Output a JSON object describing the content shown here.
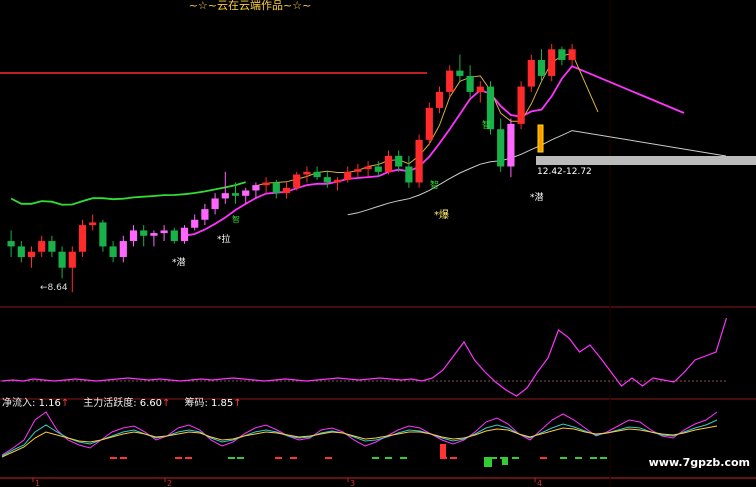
{
  "title": "~☆~云在云端作品~☆~",
  "watermark": "www.7gpzb.com",
  "colors": {
    "background": "#000000",
    "divider": "#8b1a1a",
    "resistance": "#ff2a2a",
    "up_candle": "#ff2a2a",
    "down_candle": "#19b24a",
    "pink_candle": "#ff66ff",
    "green_ma": "#33dd33",
    "magenta_ma": "#ff33ff",
    "gray_ma": "#cccccc",
    "yellow_ma": "#d4b040",
    "band": "#bbbbbb",
    "axis": "#cc2222"
  },
  "indicators": [
    {
      "name": "净流入",
      "value": "1.16",
      "arrow": "↑"
    },
    {
      "name": "主力活跃度",
      "value": "6.60",
      "arrow": "↑"
    },
    {
      "name": "筹码",
      "value": "1.85",
      "arrow": "↑"
    }
  ],
  "chart_data": {
    "type": "candlestick",
    "x_tick_labels": [
      "1",
      "2",
      "3",
      "4"
    ],
    "annotations": [
      {
        "text": "←8.64",
        "at": "low-left"
      },
      {
        "text": "*拉",
        "at": "mid"
      },
      {
        "text": "*潜",
        "at": "first-rise"
      },
      {
        "text": "*爆",
        "at": "breakout"
      },
      {
        "text": "*潜",
        "at": "pullback"
      },
      {
        "text": "12.42-12.72",
        "at": "band"
      },
      {
        "text": "智",
        "at": "markers"
      }
    ],
    "candles": [
      [
        9.6,
        9.8,
        9.3,
        9.5
      ],
      [
        9.5,
        9.6,
        9.2,
        9.3
      ],
      [
        9.3,
        9.5,
        9.1,
        9.4
      ],
      [
        9.4,
        9.7,
        9.3,
        9.6
      ],
      [
        9.6,
        9.7,
        9.3,
        9.4
      ],
      [
        9.4,
        9.5,
        8.9,
        9.1
      ],
      [
        9.1,
        9.5,
        8.64,
        9.4
      ],
      [
        9.4,
        10.0,
        9.3,
        9.9
      ],
      [
        9.9,
        10.1,
        9.8,
        9.95
      ],
      [
        9.95,
        10.0,
        9.4,
        9.5
      ],
      [
        9.5,
        9.6,
        9.2,
        9.3
      ],
      [
        9.3,
        9.7,
        9.2,
        9.6
      ],
      [
        9.6,
        9.9,
        9.5,
        9.8
      ],
      [
        9.8,
        9.9,
        9.5,
        9.7
      ],
      [
        9.7,
        9.8,
        9.5,
        9.75
      ],
      [
        9.75,
        9.9,
        9.6,
        9.8
      ],
      [
        9.8,
        9.85,
        9.55,
        9.6
      ],
      [
        9.6,
        9.9,
        9.55,
        9.85
      ],
      [
        9.85,
        10.1,
        9.8,
        10.0
      ],
      [
        10.0,
        10.3,
        9.9,
        10.2
      ],
      [
        10.2,
        10.5,
        10.1,
        10.4
      ],
      [
        10.4,
        10.9,
        10.3,
        10.5
      ],
      [
        10.5,
        10.7,
        10.3,
        10.45
      ],
      [
        10.45,
        10.6,
        10.3,
        10.55
      ],
      [
        10.55,
        10.7,
        10.4,
        10.65
      ],
      [
        10.65,
        10.8,
        10.5,
        10.7
      ],
      [
        10.7,
        10.75,
        10.4,
        10.5
      ],
      [
        10.5,
        10.7,
        10.4,
        10.6
      ],
      [
        10.6,
        10.9,
        10.55,
        10.85
      ],
      [
        10.85,
        11.0,
        10.7,
        10.9
      ],
      [
        10.9,
        11.0,
        10.75,
        10.8
      ],
      [
        10.8,
        10.9,
        10.6,
        10.7
      ],
      [
        10.7,
        10.8,
        10.55,
        10.75
      ],
      [
        10.75,
        11.0,
        10.7,
        10.9
      ],
      [
        10.9,
        11.05,
        10.8,
        10.95
      ],
      [
        10.95,
        11.1,
        10.8,
        11.0
      ],
      [
        11.0,
        11.1,
        10.8,
        10.9
      ],
      [
        10.9,
        11.3,
        10.85,
        11.2
      ],
      [
        11.2,
        11.3,
        10.9,
        11.0
      ],
      [
        11.0,
        11.2,
        10.6,
        10.7
      ],
      [
        10.7,
        11.6,
        10.6,
        11.5
      ],
      [
        11.5,
        12.2,
        11.4,
        12.1
      ],
      [
        12.1,
        12.5,
        12.0,
        12.4
      ],
      [
        12.4,
        12.9,
        12.3,
        12.8
      ],
      [
        12.8,
        13.1,
        12.6,
        12.7
      ],
      [
        12.7,
        12.9,
        12.3,
        12.4
      ],
      [
        12.4,
        12.6,
        12.2,
        12.5
      ],
      [
        12.5,
        12.6,
        11.6,
        11.7
      ],
      [
        11.7,
        11.9,
        10.9,
        11.0
      ],
      [
        11.0,
        11.9,
        10.8,
        11.8
      ],
      [
        11.8,
        12.6,
        11.7,
        12.5
      ],
      [
        12.5,
        13.1,
        12.4,
        13.0
      ],
      [
        13.0,
        13.2,
        12.6,
        12.7
      ],
      [
        12.7,
        13.3,
        12.6,
        13.2
      ],
      [
        13.2,
        13.25,
        12.9,
        13.0
      ],
      [
        13.0,
        13.3,
        12.9,
        13.2
      ]
    ],
    "y_range": [
      8.4,
      13.9
    ]
  }
}
